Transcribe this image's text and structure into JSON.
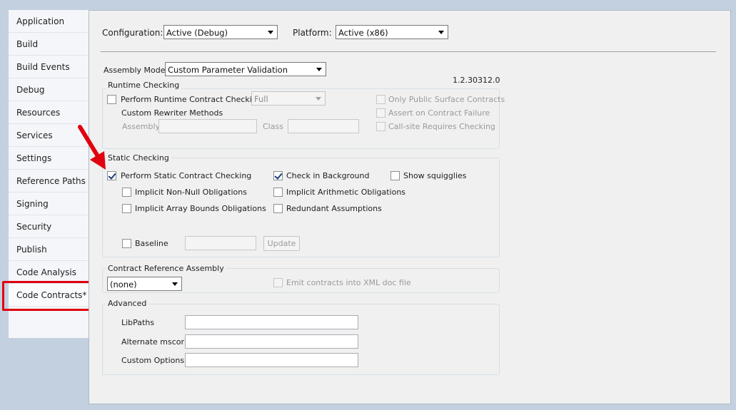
{
  "nav": {
    "items": [
      {
        "label": "Application"
      },
      {
        "label": "Build"
      },
      {
        "label": "Build Events"
      },
      {
        "label": "Debug"
      },
      {
        "label": "Resources"
      },
      {
        "label": "Services"
      },
      {
        "label": "Settings"
      },
      {
        "label": "Reference Paths"
      },
      {
        "label": "Signing"
      },
      {
        "label": "Security"
      },
      {
        "label": "Publish"
      },
      {
        "label": "Code Analysis"
      },
      {
        "label": "Code Contracts*"
      }
    ],
    "active_index": 12
  },
  "header": {
    "configuration_label": "Configuration:",
    "configuration_value": "Active (Debug)",
    "platform_label": "Platform:",
    "platform_value": "Active (x86)"
  },
  "assembly_mode": {
    "label": "Assembly Mode:",
    "value": "Custom Parameter Validation",
    "version": "1.2.30312.0"
  },
  "runtime_checking": {
    "title": "Runtime Checking",
    "perform_label": "Perform Runtime Contract Checking",
    "level_value": "Full",
    "only_public_label": "Only Public Surface Contracts",
    "assert_failure_label": "Assert on Contract Failure",
    "callsite_label": "Call-site Requires Checking",
    "rewriter_title": "Custom Rewriter Methods",
    "assembly_label": "Assembly",
    "class_label": "Class"
  },
  "static_checking": {
    "title": "Static Checking",
    "perform_label": "Perform Static Contract Checking",
    "background_label": "Check in Background",
    "squigglies_label": "Show squigglies",
    "non_null_label": "Implicit Non-Null Obligations",
    "arithmetic_label": "Implicit Arithmetic Obligations",
    "array_bounds_label": "Implicit Array Bounds Obligations",
    "redundant_label": "Redundant Assumptions",
    "baseline_label": "Baseline",
    "update_label": "Update"
  },
  "contract_reference": {
    "title": "Contract Reference Assembly",
    "value": "(none)",
    "emit_xml_label": "Emit contracts into XML doc file"
  },
  "advanced": {
    "title": "Advanced",
    "libpaths_label": "LibPaths",
    "mscorlib_label": "Alternate mscorlib",
    "custom_options_label": "Custom Options"
  },
  "colors": {
    "annotation_red": "#e0000f",
    "window_bg": "#c3d0e0",
    "panel_bg": "#f0f0f0"
  }
}
